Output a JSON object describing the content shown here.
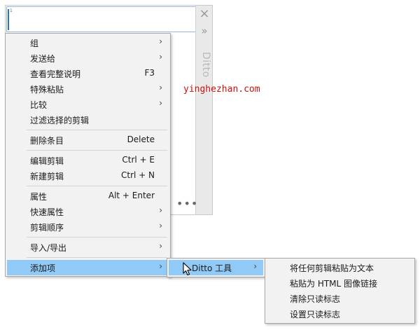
{
  "ditto_window": {
    "row_number": "1",
    "brand": "Ditto",
    "close_icon": "close-icon",
    "expand_icon": "double-chevron-right-icon",
    "more_label": "•••"
  },
  "watermark": "yinghezhan.com",
  "main_menu": {
    "items": [
      {
        "label": "组",
        "shortcut": "",
        "submenu": true
      },
      {
        "label": "发送给",
        "shortcut": "",
        "submenu": true
      },
      {
        "label": "查看完整说明",
        "shortcut": "F3",
        "submenu": false
      },
      {
        "label": "特殊粘贴",
        "shortcut": "",
        "submenu": true
      },
      {
        "label": "比较",
        "shortcut": "",
        "submenu": true
      },
      {
        "label": "过滤选择的剪辑",
        "shortcut": "",
        "submenu": false
      },
      {
        "label": "删除条目",
        "shortcut": "Delete",
        "submenu": false
      },
      {
        "label": "编辑剪辑",
        "shortcut": "Ctrl + E",
        "submenu": false
      },
      {
        "label": "新建剪辑",
        "shortcut": "Ctrl + N",
        "submenu": false
      },
      {
        "label": "属性",
        "shortcut": "Alt + Enter",
        "submenu": false
      },
      {
        "label": "快速属性",
        "shortcut": "",
        "submenu": true
      },
      {
        "label": "剪辑顺序",
        "shortcut": "",
        "submenu": true
      },
      {
        "label": "导入/导出",
        "shortcut": "",
        "submenu": true
      },
      {
        "label": "添加项",
        "shortcut": "",
        "submenu": true
      }
    ],
    "chevron": "›"
  },
  "addins_menu": {
    "items": [
      {
        "label": "Ditto 工具",
        "submenu": true
      }
    ]
  },
  "tools_menu": {
    "items": [
      {
        "label": "将任何剪辑粘贴为文本"
      },
      {
        "label": "粘贴为 HTML 图像链接"
      },
      {
        "label": "清除只读标志"
      },
      {
        "label": "设置只读标志"
      }
    ]
  },
  "colors": {
    "menu_bg": "#f2f2f2",
    "highlight": "#91c9f7",
    "watermark": "#cc1111"
  }
}
